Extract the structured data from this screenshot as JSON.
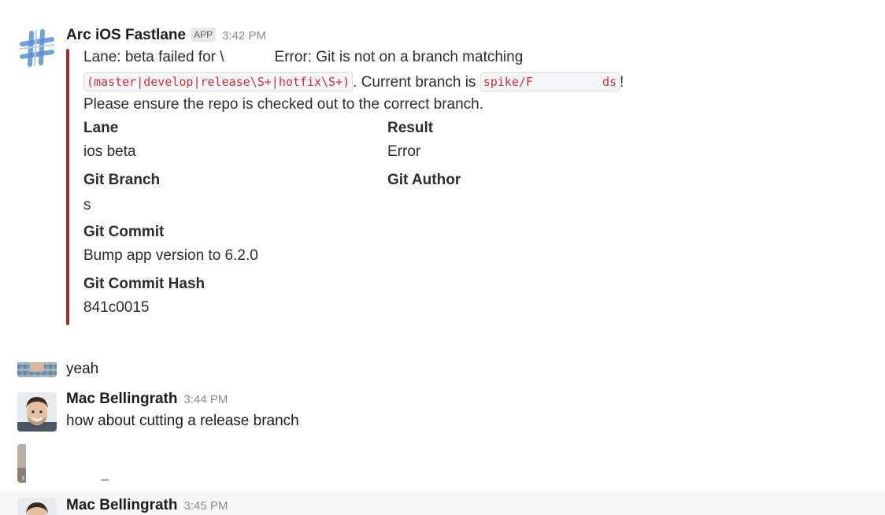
{
  "app_message": {
    "sender": "Arc iOS Fastlane",
    "badge": "APP",
    "time": "3:42 PM",
    "text_line1_a": "Lane: beta failed for \\",
    "text_line1_b": "Error: Git is not on a branch matching",
    "code_pattern": "(master|develop|release\\S+|hotfix\\S+)",
    "text_line2_mid": ". Current branch is",
    "code_branch_a": "spike/F",
    "code_branch_b": "ds",
    "text_line2_end": "!",
    "text_line3": "Please ensure the repo is checked out to the correct branch.",
    "fields": {
      "lane_title": "Lane",
      "lane_value": "ios beta",
      "result_title": "Result",
      "result_value": "Error",
      "git_branch_title": "Git Branch",
      "git_branch_value": "s",
      "git_author_title": "Git Author",
      "git_commit_title": "Git Commit",
      "git_commit_value": "Bump app version to 6.2.0",
      "git_commit_hash_title": "Git Commit Hash",
      "git_commit_hash_value": "841c0015"
    },
    "accent_color": "#a52a2a"
  },
  "messages": [
    {
      "text": "yeah"
    },
    {
      "sender": "Mac Bellingrath",
      "time": "3:44 PM",
      "text": "how about cutting a release branch"
    },
    {
      "sender": "Mac Bellingrath",
      "time": "3:45 PM"
    }
  ]
}
